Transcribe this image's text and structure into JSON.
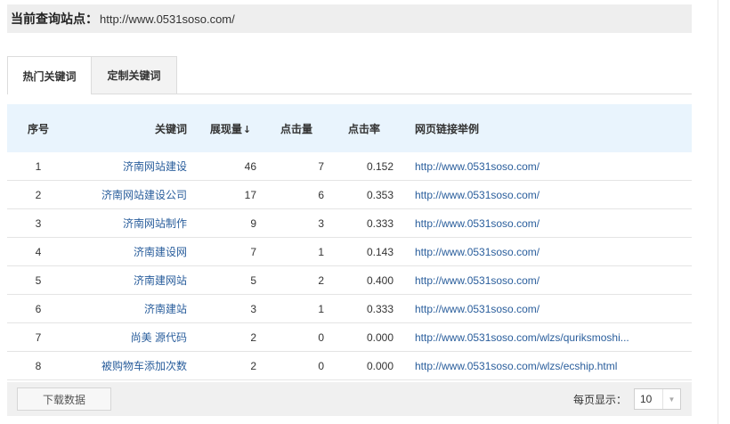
{
  "site": {
    "label": "当前查询站点：",
    "url": "http://www.0531soso.com/"
  },
  "tabs": [
    {
      "label": "热门关键词",
      "active": true
    },
    {
      "label": "定制关键词",
      "active": false
    }
  ],
  "table": {
    "headers": {
      "index": "序号",
      "keyword": "关键词",
      "impressions": "展现量",
      "sort_icon": "↓",
      "clicks": "点击量",
      "ctr": "点击率",
      "url": "网页链接举例"
    },
    "rows": [
      {
        "index": "1",
        "keyword": "济南网站建设",
        "impressions": "46",
        "clicks": "7",
        "ctr": "0.152",
        "url": "http://www.0531soso.com/"
      },
      {
        "index": "2",
        "keyword": "济南网站建设公司",
        "impressions": "17",
        "clicks": "6",
        "ctr": "0.353",
        "url": "http://www.0531soso.com/"
      },
      {
        "index": "3",
        "keyword": "济南网站制作",
        "impressions": "9",
        "clicks": "3",
        "ctr": "0.333",
        "url": "http://www.0531soso.com/"
      },
      {
        "index": "4",
        "keyword": "济南建设网",
        "impressions": "7",
        "clicks": "1",
        "ctr": "0.143",
        "url": "http://www.0531soso.com/"
      },
      {
        "index": "5",
        "keyword": "济南建网站",
        "impressions": "5",
        "clicks": "2",
        "ctr": "0.400",
        "url": "http://www.0531soso.com/"
      },
      {
        "index": "6",
        "keyword": "济南建站",
        "impressions": "3",
        "clicks": "1",
        "ctr": "0.333",
        "url": "http://www.0531soso.com/"
      },
      {
        "index": "7",
        "keyword": "尚美 源代码",
        "impressions": "2",
        "clicks": "0",
        "ctr": "0.000",
        "url": "http://www.0531soso.com/wlzs/quriksmoshi..."
      },
      {
        "index": "8",
        "keyword": "被购物车添加次数",
        "impressions": "2",
        "clicks": "0",
        "ctr": "0.000",
        "url": "http://www.0531soso.com/wlzs/ecship.html"
      }
    ]
  },
  "footer": {
    "download_label": "下载数据",
    "per_page_label": "每页显示：",
    "per_page_value": "10",
    "select_icon": "chevron-down-icon"
  }
}
